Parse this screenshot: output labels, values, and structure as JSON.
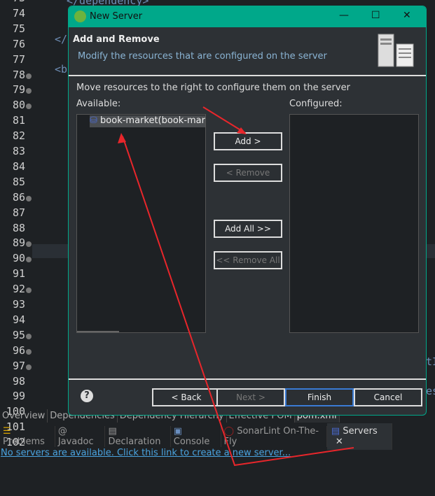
{
  "editor": {
    "lines": [
      "73",
      "74",
      "75",
      "76",
      "77",
      "78",
      "79",
      "80",
      "81",
      "82",
      "83",
      "84",
      "85",
      "86",
      "87",
      "88",
      "89",
      "90",
      "91",
      "92",
      "93",
      "94",
      "95",
      "96",
      "97",
      "98",
      "99",
      "100",
      "101",
      "102"
    ],
    "folds": [
      "78",
      "79",
      "80",
      "86",
      "89",
      "90",
      "92",
      "95",
      "96",
      "97"
    ],
    "snippets": {
      "s73": "</dependency>",
      "s76": "</d",
      "s78": "<bu",
      "s99": "tI",
      "s101": "es"
    }
  },
  "dialog": {
    "title": "New Server",
    "header_title": "Add and Remove",
    "header_desc": "Modify the resources that are configured on the server",
    "instruction": "Move resources to the right to configure them on the server",
    "available_label": "Available:",
    "configured_label": "Configured:",
    "available_items": [
      "book-market(book-market)"
    ],
    "buttons": {
      "add": "Add >",
      "remove": "< Remove",
      "add_all": "Add All >>",
      "remove_all": "<< Remove All",
      "back": "< Back",
      "next": "Next >",
      "finish": "Finish",
      "cancel": "Cancel",
      "help": "?"
    },
    "window_controls": {
      "minimize": "—",
      "maximize": "☐",
      "close": "✕"
    }
  },
  "editor_tabs": [
    "Overview",
    "Dependencies",
    "Dependency Hierarchy",
    "Effective POM",
    "pom.xml"
  ],
  "view_tabs": [
    "Problems",
    "Javadoc",
    "Declaration",
    "Console",
    "SonarLint On-The-Fly",
    "Servers"
  ],
  "servers_view": {
    "link": "No servers are available. Click this link to create a new server..."
  },
  "colors": {
    "accent": "#00a88a",
    "annotation": "#e8262b",
    "link": "#4aa3df"
  }
}
